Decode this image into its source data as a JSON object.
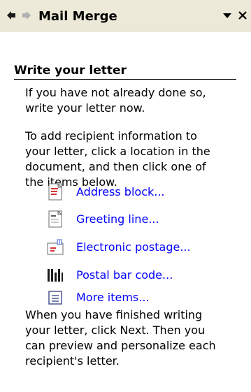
{
  "header": {
    "title": "Mail Merge",
    "back_icon": "back-arrow-icon",
    "forward_icon": "forward-arrow-icon",
    "menu_icon": "dropdown-triangle-icon",
    "close_icon": "close-icon"
  },
  "section": {
    "title": "Write your letter"
  },
  "paragraphs": {
    "intro": "If you have not already done so,\nwrite your letter now.",
    "instruction": "To add recipient information to\nyour letter, click a location in the\ndocument, and then click one of\nthe items below.",
    "finish": "When you have finished writing\nyour letter, click Next. Then you\ncan preview and personalize each\nrecipient's letter."
  },
  "items": [
    {
      "label": "Address block...",
      "icon": "address-block-icon"
    },
    {
      "label": "Greeting line...",
      "icon": "greeting-line-icon"
    },
    {
      "label": "Electronic postage...",
      "icon": "electronic-postage-icon"
    },
    {
      "label": "Postal bar code...",
      "icon": "postal-bar-code-icon"
    },
    {
      "label": "More items...",
      "icon": "more-items-icon"
    }
  ],
  "colors": {
    "header_bg": "#ece9d8",
    "link": "#0000ff",
    "icon_red": "#cc0000"
  }
}
